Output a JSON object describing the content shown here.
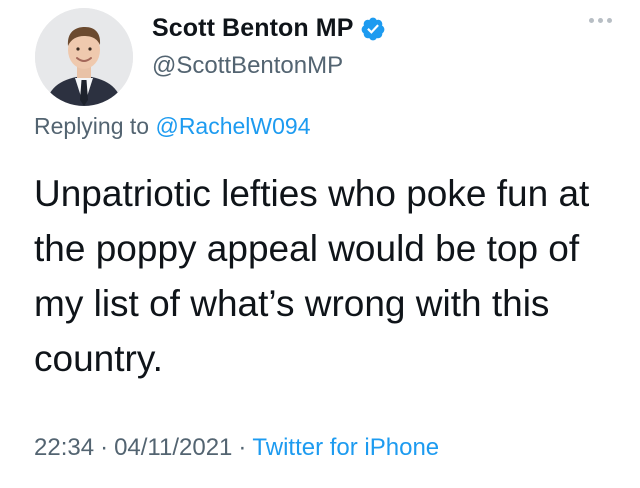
{
  "author": {
    "display_name": "Scott Benton MP",
    "handle": "@ScottBentonMP",
    "verified": true,
    "avatar_icon": "profile-photo"
  },
  "reply": {
    "prefix": "Replying to ",
    "mention": "@RachelW094"
  },
  "tweet": {
    "text": "Unpatriotic lefties who poke fun at the poppy appeal would be top of my list of what’s wrong with this country."
  },
  "meta": {
    "time": "22:34",
    "separator": "·",
    "date": "04/11/2021",
    "source": "Twitter for iPhone"
  },
  "icons": {
    "verified": "verified-badge-icon",
    "more": "more-options-icon"
  },
  "colors": {
    "text": "#0f1419",
    "secondary": "#536471",
    "link": "#1d9bf0",
    "verified": "#1d9bf0"
  }
}
